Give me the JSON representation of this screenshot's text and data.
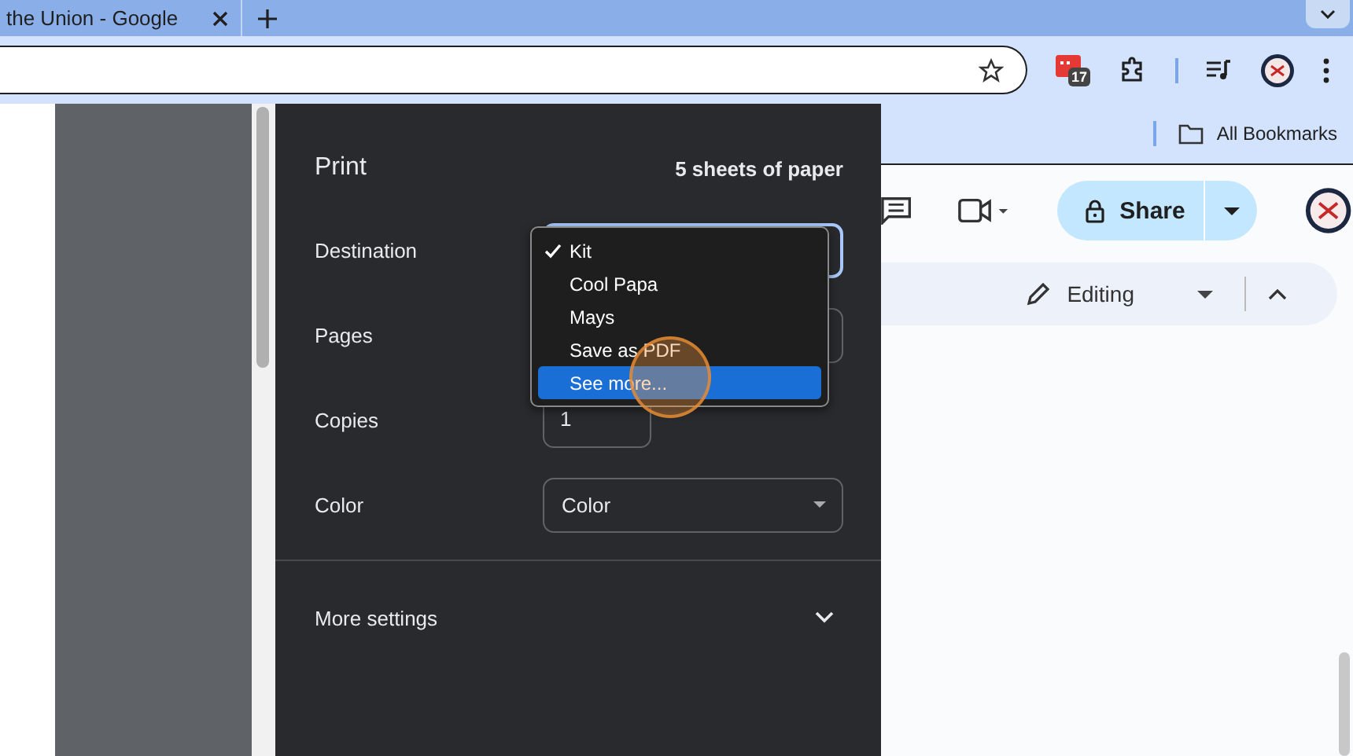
{
  "browser": {
    "tab": {
      "title": "the Union - Google"
    },
    "calendar_badge": "17",
    "bookmarks": {
      "label": "All Bookmarks"
    }
  },
  "print": {
    "title": "Print",
    "summary": "5 sheets of paper",
    "settings": [
      {
        "label": "Destination",
        "kind": "select",
        "open": true
      },
      {
        "label": "Pages",
        "kind": "select"
      },
      {
        "label": "Copies",
        "kind": "input",
        "value": "1"
      },
      {
        "label": "Color",
        "kind": "select",
        "value": "Color"
      }
    ],
    "destination_menu": [
      {
        "label": "Kit",
        "checked": true,
        "selected": false
      },
      {
        "label": "Cool Papa",
        "checked": false,
        "selected": false
      },
      {
        "label": "Mays",
        "checked": false,
        "selected": false
      },
      {
        "label": "Save as PDF",
        "checked": false,
        "selected": false
      },
      {
        "label": "See more...",
        "checked": false,
        "selected": true
      }
    ],
    "more_settings": {
      "label": "More settings",
      "expanded": false
    }
  },
  "docs": {
    "share": "Share",
    "mode": "Editing"
  }
}
